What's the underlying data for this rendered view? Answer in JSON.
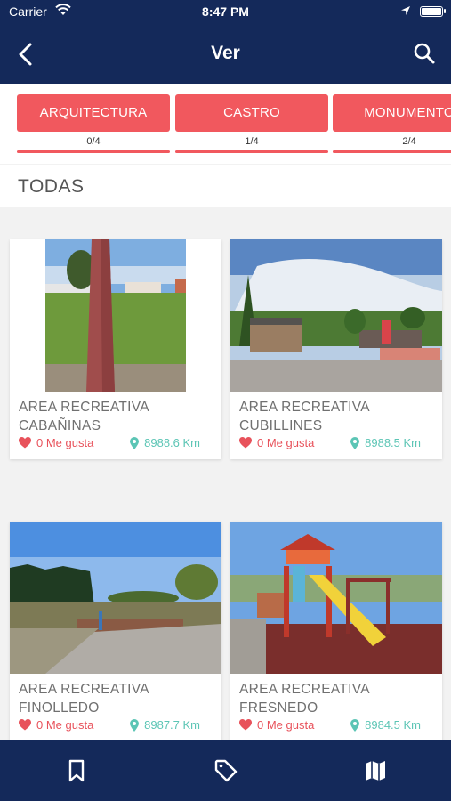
{
  "status_bar": {
    "carrier": "Carrier",
    "time": "8:47 PM"
  },
  "navbar": {
    "title": "Ver",
    "back_icon": "back-chevron-icon",
    "search_icon": "search-icon"
  },
  "colors": {
    "navy": "#14295a",
    "accent": "#f1585e",
    "distance": "#5cc5b5"
  },
  "categories": [
    {
      "label": "ARQUITECTURA",
      "count": "0/4"
    },
    {
      "label": "CASTRO",
      "count": "1/4"
    },
    {
      "label": "MONUMENTO",
      "count": "2/4"
    }
  ],
  "section": {
    "label": "TODAS"
  },
  "places": [
    {
      "name_line1": "AREA RECREATIVA",
      "name_line2": "CABAÑINAS",
      "likes": "0 Me gusta",
      "distance": "8988.6 Km"
    },
    {
      "name_line1": "AREA RECREATIVA",
      "name_line2": "CUBILLINES",
      "likes": "0 Me gusta",
      "distance": "8988.5 Km"
    },
    {
      "name_line1": "AREA RECREATIVA",
      "name_line2": "FINOLLEDO",
      "likes": "0 Me gusta",
      "distance": "8987.7 Km"
    },
    {
      "name_line1": "AREA RECREATIVA",
      "name_line2": "FRESNEDO",
      "likes": "0 Me gusta",
      "distance": "8984.5 Km"
    }
  ],
  "tab_bar": {
    "icons": [
      "bookmark-icon",
      "tag-icon",
      "map-icon"
    ]
  }
}
